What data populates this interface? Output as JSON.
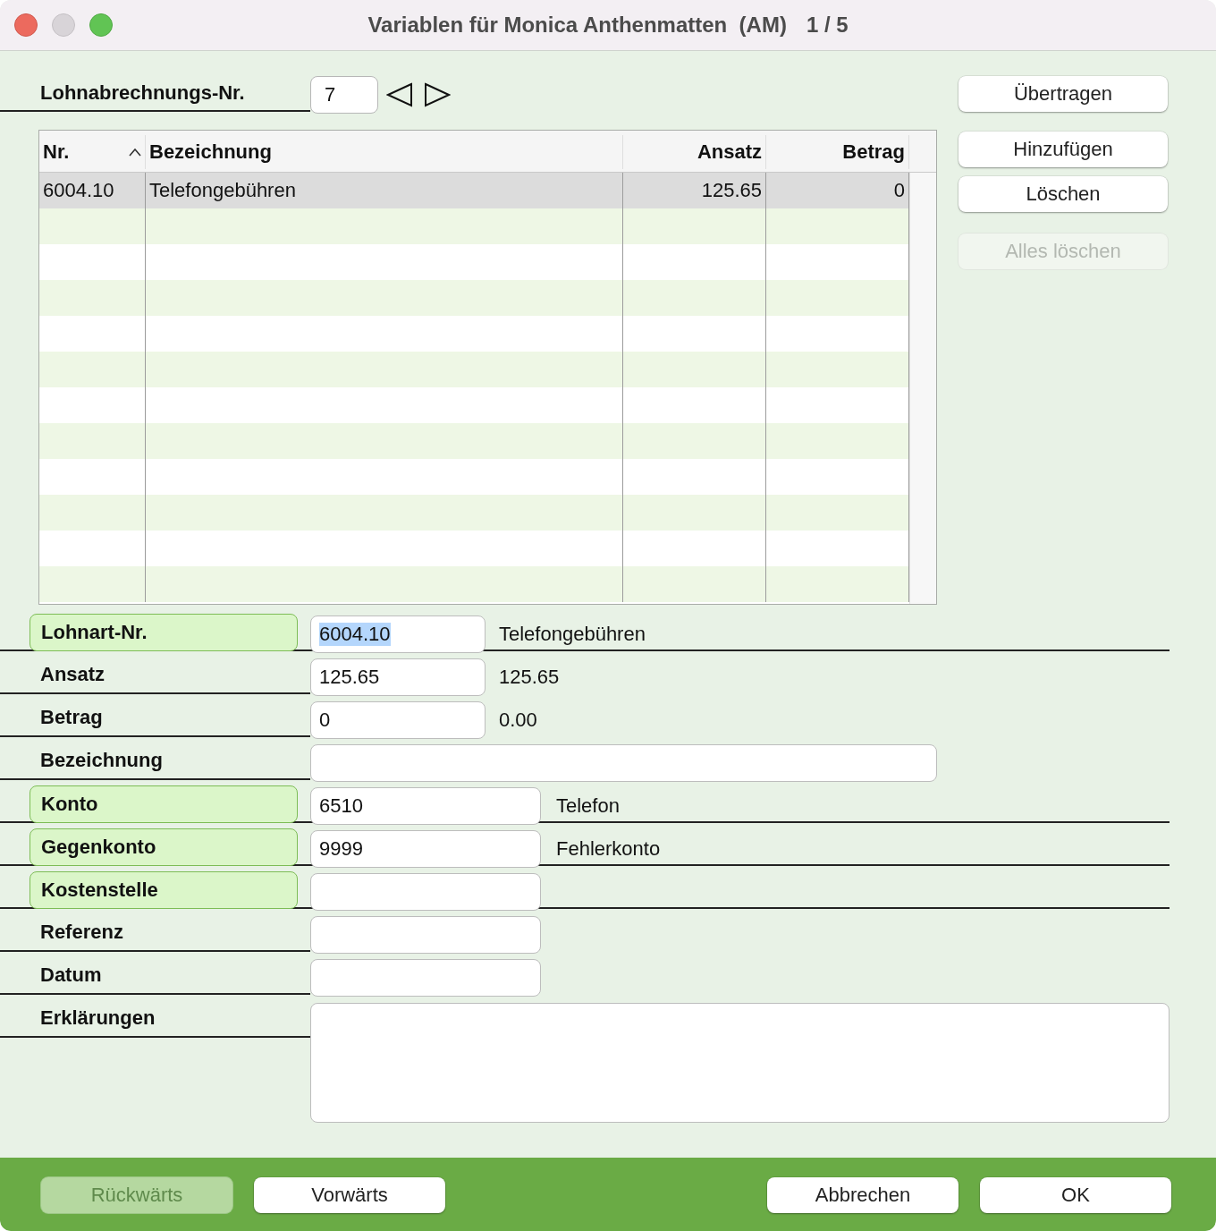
{
  "window": {
    "title": "Variablen für Monica Anthenmatten  (AM)",
    "counter": "1 / 5"
  },
  "payroll": {
    "label": "Lohnabrechnungs-Nr.",
    "value": "7"
  },
  "table": {
    "columns": [
      {
        "label": "Nr.",
        "sorted": true,
        "numeric": false
      },
      {
        "label": "Bezeichnung",
        "sorted": false,
        "numeric": false
      },
      {
        "label": "Ansatz",
        "sorted": false,
        "numeric": true
      },
      {
        "label": "Betrag",
        "sorted": false,
        "numeric": true
      }
    ],
    "rows": [
      {
        "cells": [
          "6004.10",
          "Telefongebühren",
          "125.65",
          "0"
        ],
        "selected": true
      }
    ]
  },
  "side_buttons": [
    {
      "label": "Übertragen",
      "disabled": false
    },
    {
      "label": "Hinzufügen",
      "disabled": false
    },
    {
      "label": "Löschen",
      "disabled": false
    },
    {
      "label": "Alles löschen",
      "disabled": true
    }
  ],
  "form": [
    {
      "label": "Lohnart-Nr.",
      "kind": "amount",
      "highlighted": true,
      "value": "6004.10",
      "value_selected": true,
      "info": "Telefongebühren"
    },
    {
      "label": "Ansatz",
      "kind": "amount",
      "highlighted": false,
      "value": "125.65",
      "value_selected": false,
      "info": "125.65"
    },
    {
      "label": "Betrag",
      "kind": "amount",
      "highlighted": false,
      "value": "0",
      "value_selected": false,
      "info": "0.00"
    },
    {
      "label": "Bezeichnung",
      "kind": "text",
      "highlighted": false
    },
    {
      "label": "Konto",
      "kind": "account",
      "highlighted": true,
      "value": "6510",
      "value_selected": false,
      "info": "Telefon"
    },
    {
      "label": "Gegenkonto",
      "kind": "account",
      "highlighted": true,
      "value": "9999",
      "value_selected": false,
      "info": "Fehlerkonto"
    },
    {
      "label": "Kostenstelle",
      "kind": "account",
      "highlighted": true
    },
    {
      "label": "Referenz",
      "kind": "account",
      "highlighted": false
    },
    {
      "label": "Datum",
      "kind": "account",
      "highlighted": false
    },
    {
      "label": "Erklärungen",
      "kind": "memo",
      "highlighted": false
    }
  ],
  "footer": {
    "left": [
      {
        "label": "Rückwärts",
        "disabled": true
      },
      {
        "label": "Vorwärts",
        "disabled": false
      }
    ],
    "right": [
      {
        "label": "Abbrechen",
        "disabled": false
      },
      {
        "label": "OK",
        "disabled": false
      }
    ]
  }
}
